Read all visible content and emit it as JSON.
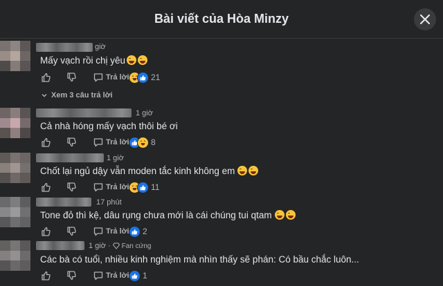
{
  "header": {
    "title": "Bài viết của Hòa Minzy"
  },
  "comments": [
    {
      "time": "giờ",
      "text": "Mấy vạch rồi chị yêu",
      "reply_label": "Trả lời",
      "reaction_count": "21",
      "view_replies": "Xem 3 câu trả lời"
    },
    {
      "time": "1 giờ",
      "text": "Cả nhà hóng mấy vạch thôi bé ơi",
      "reply_label": "Trả lời",
      "reaction_count": "8"
    },
    {
      "time": "1 giờ",
      "text": "Chốt lại ngủ dậy vẫn moden tắc kinh không em",
      "reply_label": "Trả lời",
      "reaction_count": "11"
    },
    {
      "time": "17 phút",
      "text": "Tone đỏ thì kệ, dâu rụng chưa mới là cái chúng tui qtam",
      "reply_label": "Trả lời",
      "reaction_count": "2"
    },
    {
      "time": "1 giờ",
      "badge": "Fan cứng",
      "text": "Các bà có tuổi, nhiều kinh nghiệm mà nhìn thấy sẽ phán: Có bầu chắc luôn...",
      "reply_label": "Trả lời",
      "reaction_count": "1"
    }
  ],
  "colors": {
    "background": "#242526",
    "text": "#e4e6eb",
    "secondary": "#b0b3b8",
    "like": "#1b74e4",
    "haha": "#f7c53b"
  },
  "icons": [
    "close-icon",
    "like-icon",
    "dislike-icon",
    "comment-icon",
    "chevron-down-icon",
    "haha-emoji-icon",
    "diamond-icon"
  ]
}
